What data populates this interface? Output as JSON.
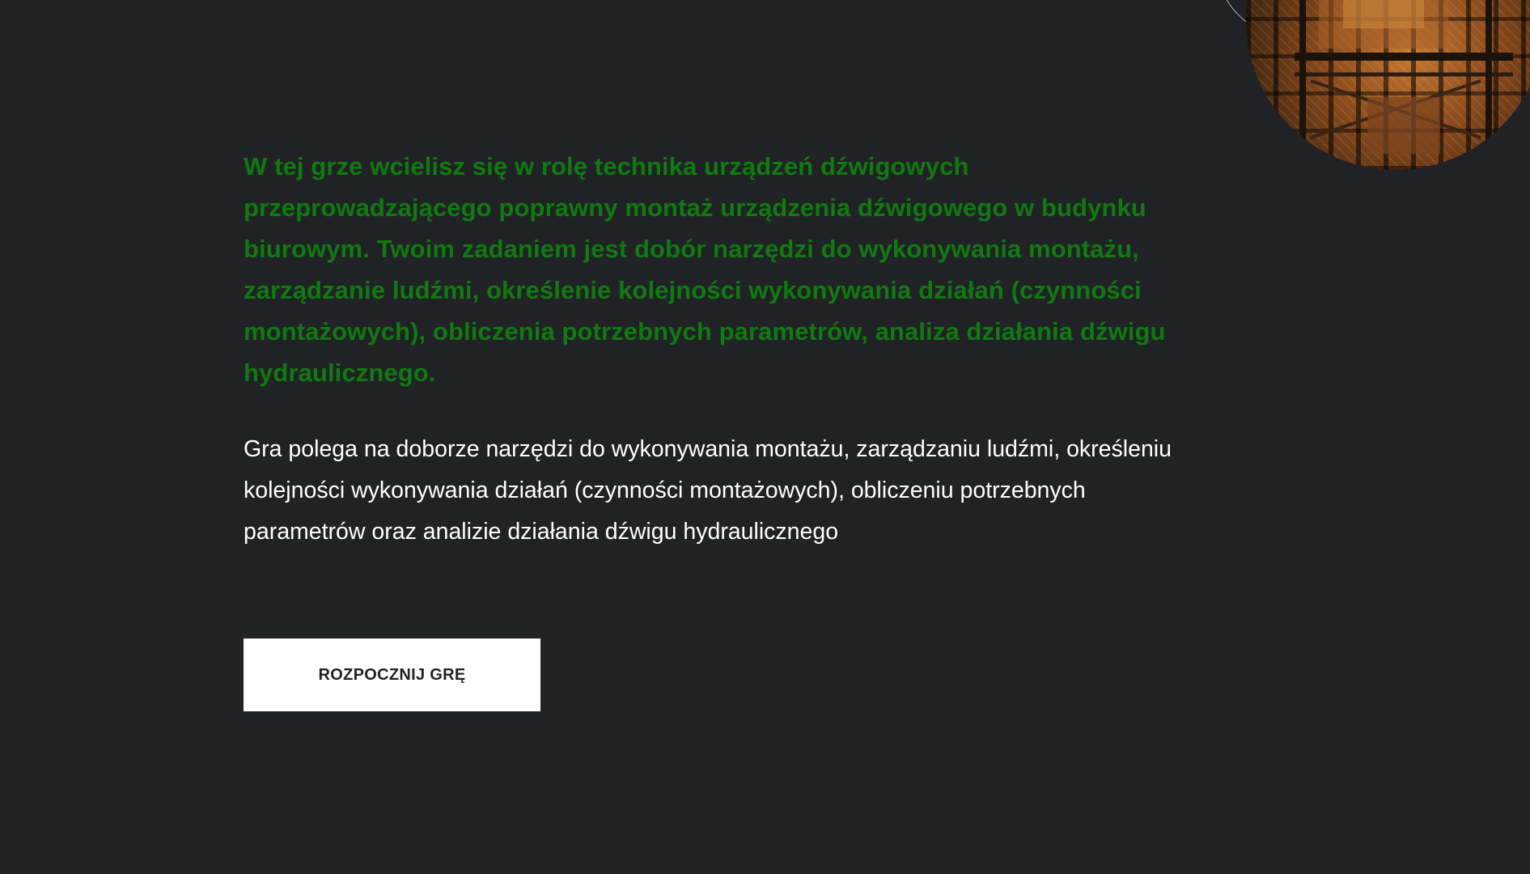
{
  "intro": {
    "lead": "W tej grze wcielisz się w rolę technika urządzeń dźwigowych przeprowadzającego poprawny montaż urządzenia dźwigowego w budynku biurowym. Twoim zadaniem jest dobór narzędzi do wykonywania montażu, zarządzanie ludźmi, określenie kolejności wykonywania działań (czynności montażowych), obliczenia potrzebnych parametrów, analiza działania dźwigu hydraulicznego.",
    "description": "Gra polega na doborze narzędzi do wykonywania montażu, zarządzaniu ludźmi, określeniu kolejności wykonywania działań (czynności montażowych), obliczeniu potrzebnych parametrów oraz analizie działania dźwigu hydraulicznego"
  },
  "actions": {
    "start_label": "ROZPOCZNIJ GRĘ"
  },
  "decoration": {
    "corner_image": "elevator-shaft-photo"
  },
  "colors": {
    "background": "#212226",
    "lead_text": "#0f7a0f",
    "body_text": "#ffffff",
    "button_bg": "#ffffff",
    "button_text": "#222226"
  }
}
